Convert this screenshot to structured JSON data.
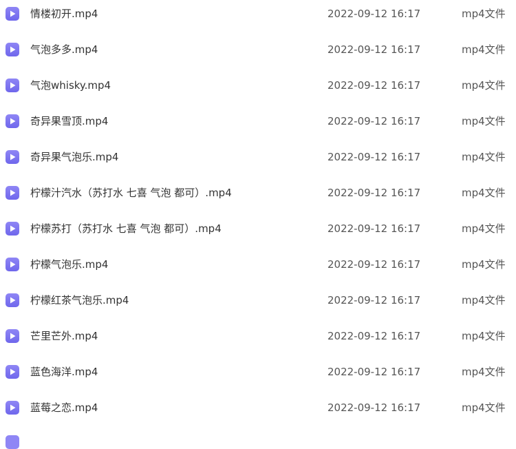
{
  "files": [
    {
      "icon": "video-file-icon",
      "name": "情楼初开.mp4",
      "date": "2022-09-12 16:17",
      "type": "mp4文件"
    },
    {
      "icon": "video-file-icon",
      "name": "气泡多多.mp4",
      "date": "2022-09-12 16:17",
      "type": "mp4文件"
    },
    {
      "icon": "video-file-icon",
      "name": "气泡whisky.mp4",
      "date": "2022-09-12 16:17",
      "type": "mp4文件"
    },
    {
      "icon": "video-file-icon",
      "name": "奇异果雪顶.mp4",
      "date": "2022-09-12 16:17",
      "type": "mp4文件"
    },
    {
      "icon": "video-file-icon",
      "name": "奇异果气泡乐.mp4",
      "date": "2022-09-12 16:17",
      "type": "mp4文件"
    },
    {
      "icon": "video-file-icon",
      "name": "柠檬汁汽水（苏打水 七喜 气泡 都可）.mp4",
      "date": "2022-09-12 16:17",
      "type": "mp4文件"
    },
    {
      "icon": "video-file-icon",
      "name": "柠檬苏打（苏打水 七喜 气泡 都可）.mp4",
      "date": "2022-09-12 16:17",
      "type": "mp4文件"
    },
    {
      "icon": "video-file-icon",
      "name": "柠檬气泡乐.mp4",
      "date": "2022-09-12 16:17",
      "type": "mp4文件"
    },
    {
      "icon": "video-file-icon",
      "name": "柠檬红茶气泡乐.mp4",
      "date": "2022-09-12 16:17",
      "type": "mp4文件"
    },
    {
      "icon": "video-file-icon",
      "name": "芒里芒外.mp4",
      "date": "2022-09-12 16:17",
      "type": "mp4文件"
    },
    {
      "icon": "video-file-icon",
      "name": "蓝色海洋.mp4",
      "date": "2022-09-12 16:17",
      "type": "mp4文件"
    },
    {
      "icon": "video-file-icon",
      "name": "蓝莓之恋.mp4",
      "date": "2022-09-12 16:17",
      "type": "mp4文件"
    }
  ],
  "colors": {
    "icon_accent": "#7b73f0",
    "text": "#333333",
    "meta_text": "#555555"
  }
}
